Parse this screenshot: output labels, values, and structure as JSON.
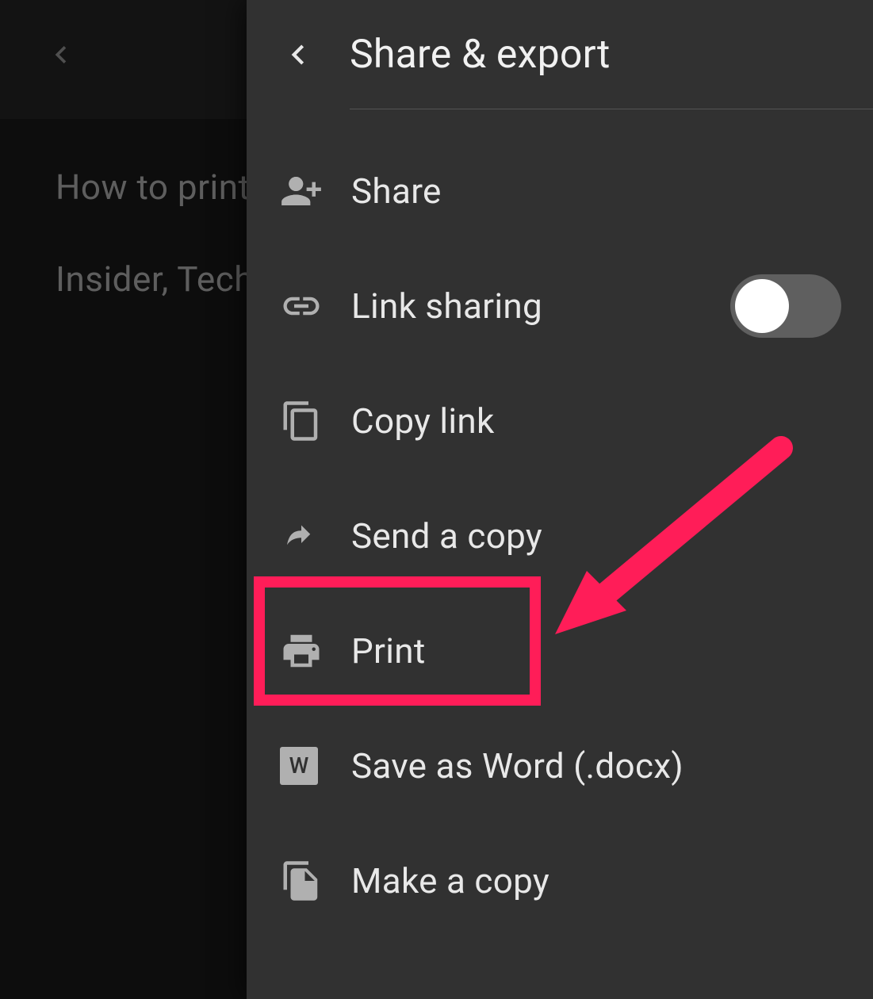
{
  "background": {
    "line1": "How to print f",
    "line2": "Insider, Tech"
  },
  "drawer": {
    "title": "Share & export",
    "items": [
      {
        "label": "Share",
        "icon": "person-add"
      },
      {
        "label": "Link sharing",
        "icon": "link",
        "toggle": true,
        "toggle_on": false
      },
      {
        "label": "Copy link",
        "icon": "copy"
      },
      {
        "label": "Send a copy",
        "icon": "arrow-redo"
      },
      {
        "label": "Print",
        "icon": "printer",
        "highlighted": true
      },
      {
        "label": "Save as Word (.docx)",
        "icon": "word-badge"
      },
      {
        "label": "Make a copy",
        "icon": "file-copy"
      }
    ]
  },
  "annotation": {
    "highlight_target": "Print",
    "color": "#ff1d58"
  }
}
